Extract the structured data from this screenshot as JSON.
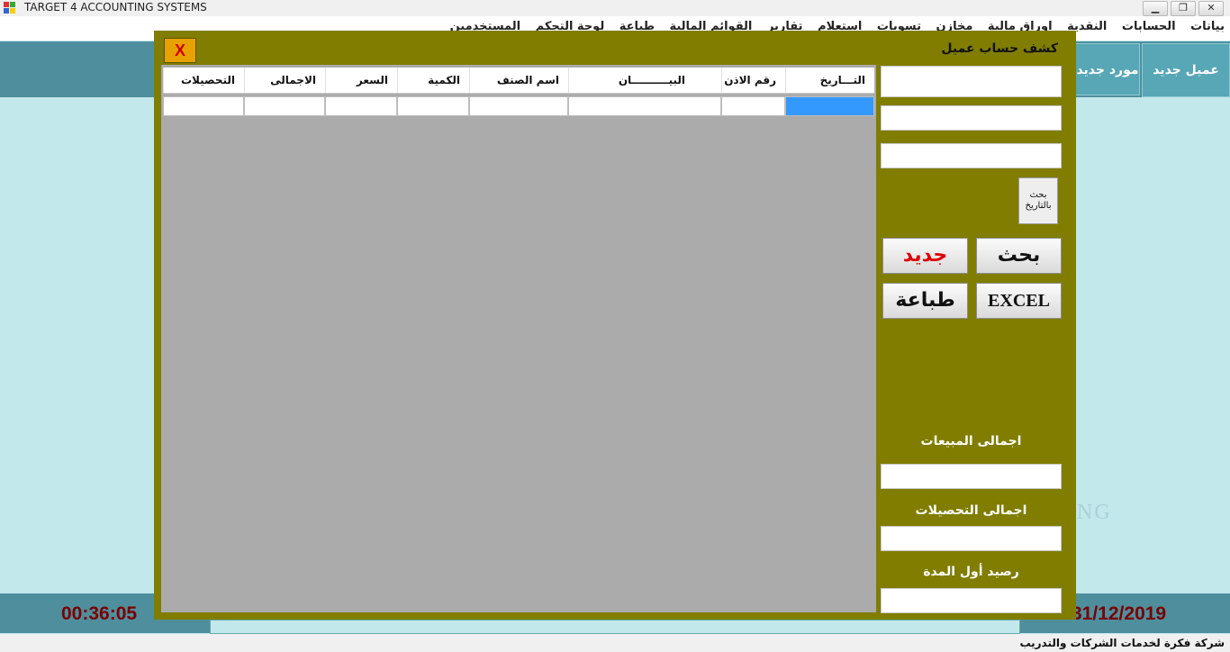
{
  "window": {
    "title": "TARGET 4 ACCOUNTING SYSTEMS",
    "controls": {
      "minimize": "▁",
      "restore": "❐",
      "close": "✕"
    }
  },
  "menu": [
    "بيانات",
    "الحسابات",
    "النقدية",
    "اوراق مالية",
    "مخازن",
    "تسويات",
    "استعلام",
    "تقارير",
    "القوائم المالية",
    "طباعة",
    "لوحة التحكم",
    "المستخدمين"
  ],
  "toolbar": {
    "new_customer": "عميل جديد",
    "new_supplier": "مورد جديد"
  },
  "footer": {
    "clock": "00:36:05",
    "date": "31/12/2019",
    "company": "شركة فكرة لخدمات الشركات والتدريب",
    "watermark": "NG"
  },
  "dialog": {
    "title": "كشف حساب عميل",
    "close_label": "X",
    "grid": {
      "columns": [
        "التـــاريخ",
        "رقم الاذن",
        "البيــــــــــان",
        "اسم الصنف",
        "الكمية",
        "السعر",
        "الاجمالى",
        "التحصيلات"
      ],
      "rows": [
        [
          "",
          "",
          "",
          "",
          "",
          "",
          "",
          ""
        ]
      ]
    },
    "buttons": {
      "search_by_date": "بحث بالتاريخ",
      "search": "بحث",
      "new": "جديد",
      "excel": "EXCEL",
      "print": "طباعة"
    },
    "labels": {
      "total_sales": "اجمالى المبيعات",
      "total_collections": "اجمالى التحصيلات",
      "opening_balance": "رصيد أول المدة"
    },
    "fields": {
      "field1": "",
      "field2": "",
      "field3": "",
      "total_sales": "",
      "total_collections": "",
      "opening_balance": ""
    }
  },
  "colors": {
    "dialog_bg": "#807d00",
    "app_bg": "#c2e8ec",
    "band": "#4f8e9d",
    "selection": "#3399ff",
    "new_button_text": "#e00000"
  },
  "icons": [
    "app-icon",
    "close-icon"
  ]
}
